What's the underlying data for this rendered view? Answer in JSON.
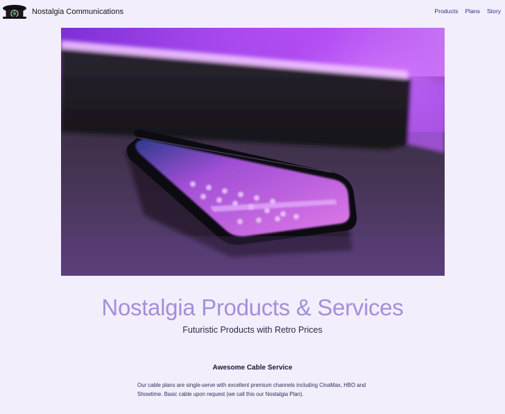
{
  "brand": {
    "name": "Nostalgia Communications",
    "logo_icon": "rotary-telephone-icon"
  },
  "nav": {
    "items": [
      {
        "label": "Products"
      },
      {
        "label": "Plans"
      },
      {
        "label": "Story"
      }
    ]
  },
  "hero": {
    "image_subject": "smartphone-under-purple-light"
  },
  "main": {
    "title": "Nostalgia Products & Services",
    "subtitle": "Futuristic Products with Retro Prices"
  },
  "section": {
    "heading": "Awesome Cable Service",
    "body": "Our cable plans are single-serve with excellent premium channels including CinaMax, HBO and Showtime. Basic cable upon request (we call this our Nostalgia Plan)."
  },
  "colors": {
    "background": "#f3eefc",
    "title": "#a48fd9",
    "nav_link": "#2b2f86",
    "hero_glow": "#b44df0"
  }
}
